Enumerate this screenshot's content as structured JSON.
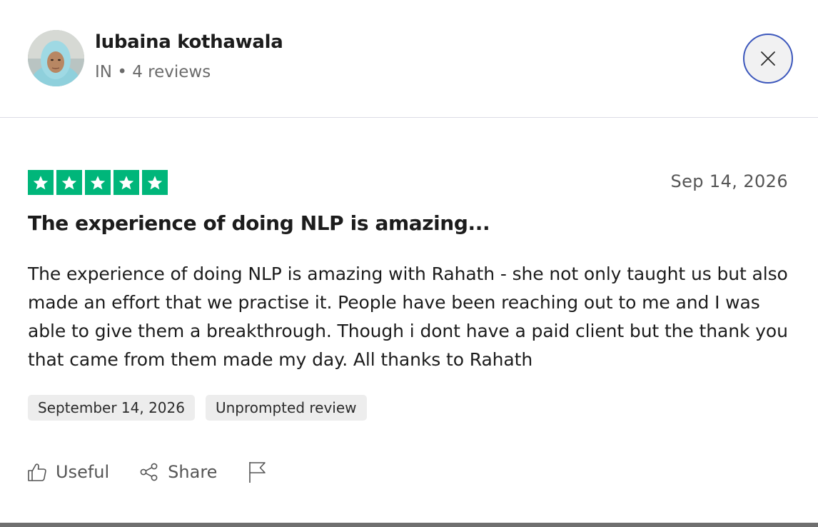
{
  "reviewer": {
    "name": "lubaina kothawala",
    "country": "IN",
    "separator": "•",
    "review_count": "4 reviews"
  },
  "close_button": {
    "aria_label": "Close"
  },
  "review": {
    "rating": 5,
    "rating_max": 5,
    "star_color": "#00b67a",
    "date_short": "Sep 14, 2026",
    "title": "The experience of doing NLP is amazing...",
    "body": "The experience of doing NLP is amazing with Rahath - she not only taught us but also made an effort that we practise it. People have been reaching out to me and I was able to give them a breakthrough. Though i dont have a paid client but the thank you that came from them made my day. All thanks to Rahath",
    "tags": {
      "date_of_experience": "September 14, 2026",
      "review_type": "Unprompted review"
    }
  },
  "actions": {
    "useful_label": "Useful",
    "share_label": "Share",
    "report_icon": "flag-icon"
  },
  "colors": {
    "star_green": "#00b67a",
    "close_border": "#3c57bc"
  }
}
